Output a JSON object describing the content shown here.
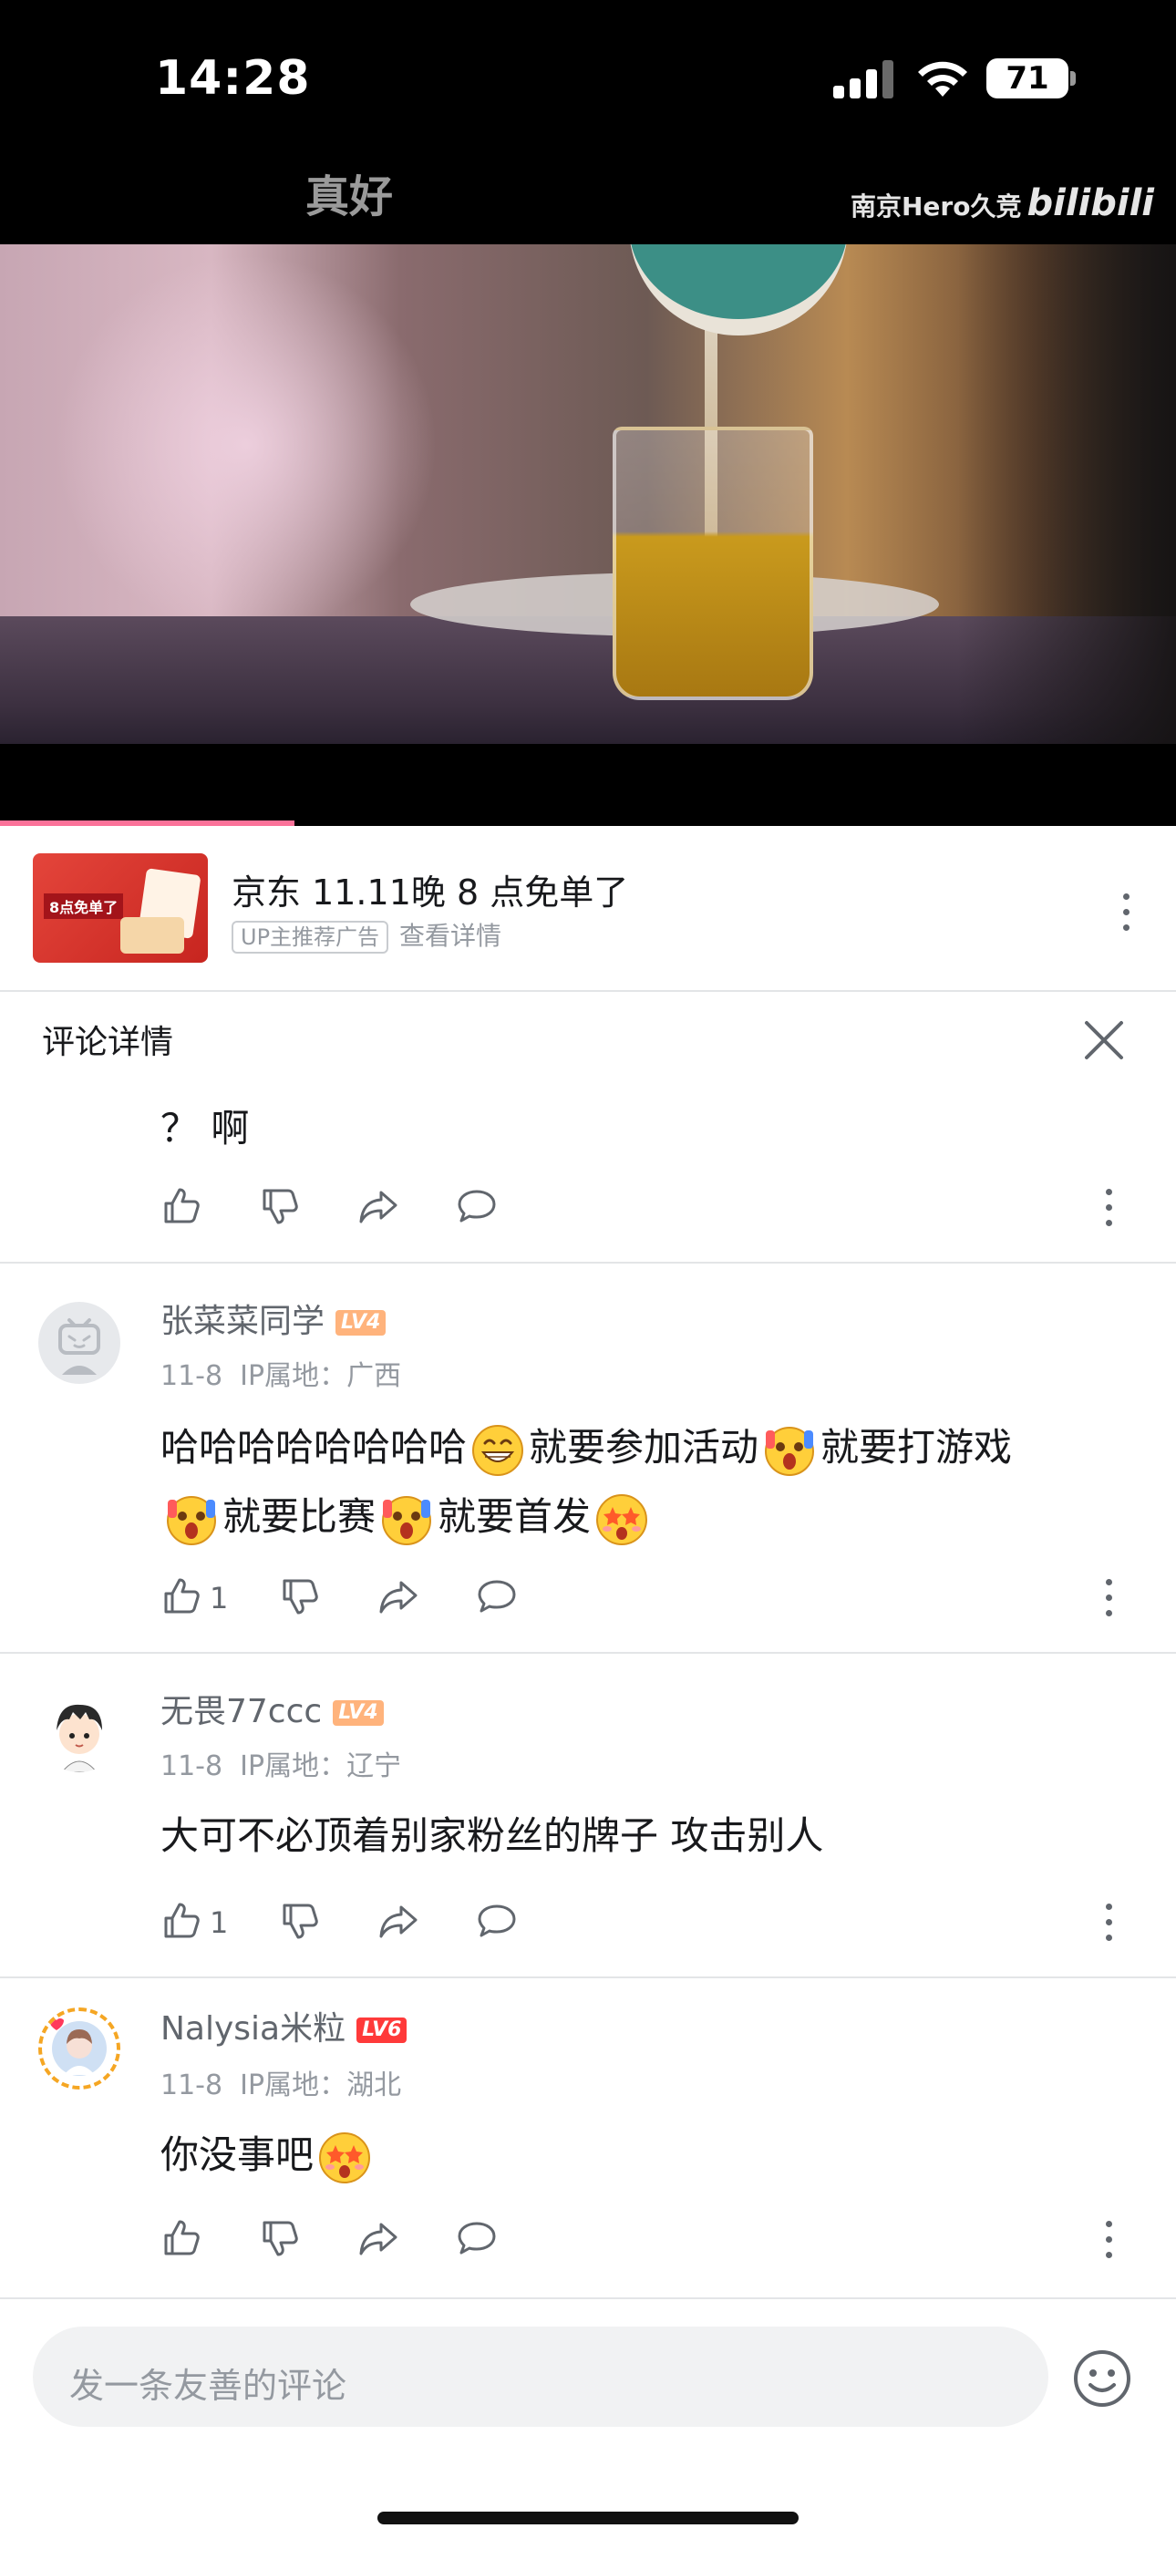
{
  "status_bar": {
    "time": "14:28",
    "battery": "71"
  },
  "video": {
    "title": "真好",
    "watermark_text": "南京Hero久竞",
    "watermark_logo": "bilibili",
    "progress_fraction": 0.25
  },
  "ad": {
    "thumb_badge": "8点免单了",
    "title": "京东 11.11晚 8 点免单了",
    "tag": "UP主推荐广告",
    "detail": "查看详情"
  },
  "comment_detail": {
    "title": "评论详情",
    "reply": {
      "text": "？ 啊"
    }
  },
  "comments": [
    {
      "user": "张菜菜同学",
      "level": "LV4",
      "level_color": "#ffb37c",
      "date": "11-8",
      "ip_label": "IP属地：",
      "ip": "广西",
      "text_parts": [
        "哈哈哈哈哈哈哈哈",
        "就要参加活动",
        "就要打游戏",
        "就要比赛",
        "就要首发"
      ],
      "likes": "1"
    },
    {
      "user": "无畏77ccc",
      "level": "LV4",
      "level_color": "#ffb37c",
      "date": "11-8",
      "ip_label": "IP属地：",
      "ip": "辽宁",
      "text": "大可不必顶着别家粉丝的牌子 攻击别人",
      "likes": "1"
    },
    {
      "user": "Nalysia米粒",
      "level": "LV6",
      "level_color": "#ff3a3a",
      "date": "11-8",
      "ip_label": "IP属地：",
      "ip": "湖北",
      "text": "你没事吧"
    }
  ],
  "input": {
    "placeholder": "发一条友善的评论"
  },
  "colors": {
    "accent": "#fb7299",
    "text_primary": "#18191c",
    "text_secondary": "#9499a0"
  },
  "icons": [
    "signal-icon",
    "wifi-icon",
    "battery-icon",
    "more-icon",
    "close-icon",
    "like-icon",
    "dislike-icon",
    "share-icon",
    "reply-icon",
    "emoji-icon"
  ]
}
